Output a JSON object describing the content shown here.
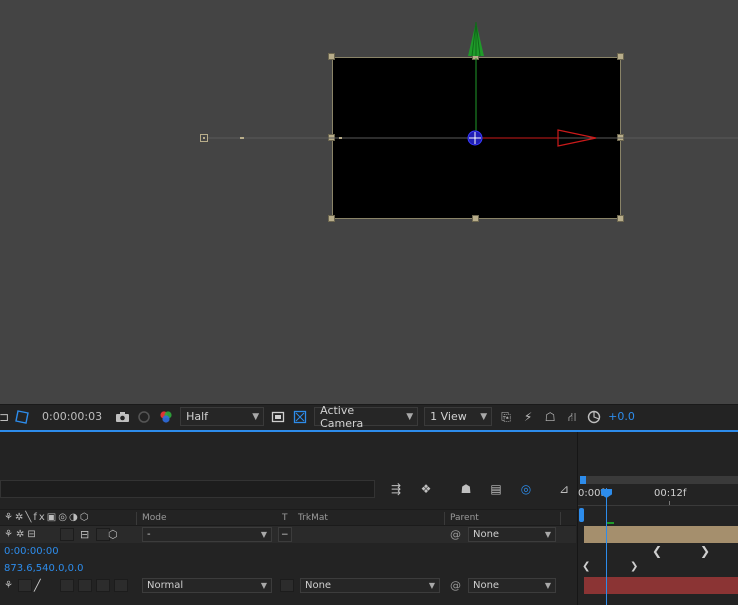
{
  "viewer": {
    "background": "#444444",
    "comp_background": "#000000",
    "y_axis_color": "#1f9a2a",
    "x_axis_color": "#cc1a1a",
    "center_color": "#2b2bd6"
  },
  "toolbar": {
    "snapshot_icon": "region-of-interest-icon",
    "timecode": "0:00:00:03",
    "resolution": "Half",
    "camera_view": "Active Camera",
    "view_layout": "1 View",
    "exposure": "+0.0"
  },
  "timeline": {
    "columns": {
      "mode": "Mode",
      "t": "T",
      "trkmat": "TrkMat",
      "parent": "Parent"
    },
    "rows": [
      {
        "mode": "-",
        "trkmat": "",
        "parent": "None"
      },
      {
        "property_value": "0:00:00:00"
      },
      {
        "property_value": "873.6,540.0,0.0"
      },
      {
        "mode": "Normal",
        "trkmat": "None",
        "parent": "None"
      }
    ],
    "ruler": {
      "start_label": "0:00f",
      "mid_label": "00:12f"
    },
    "accent_color": "#2d8ceb"
  }
}
